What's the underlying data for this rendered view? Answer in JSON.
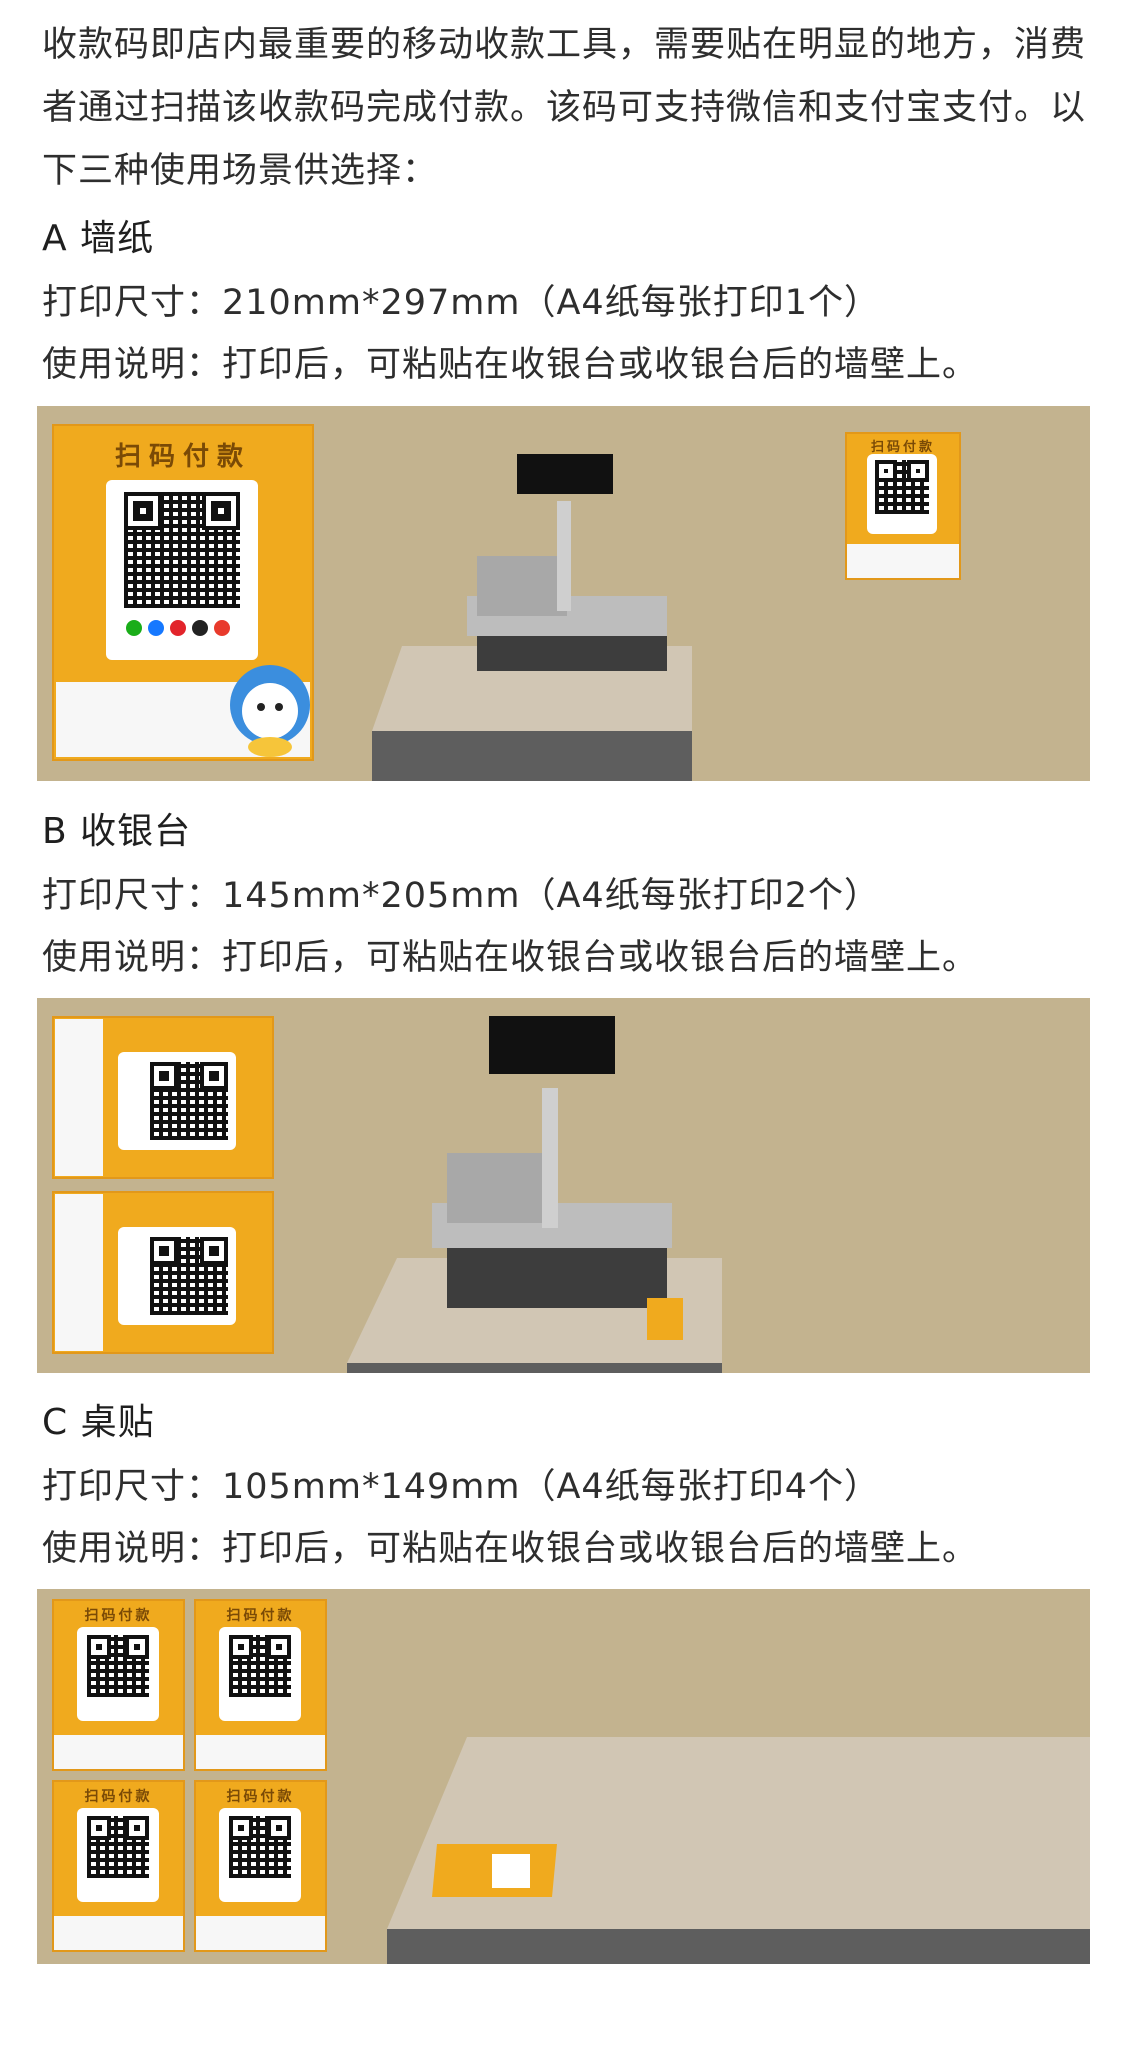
{
  "intro": {
    "text": "收款码即店内最重要的移动收款工具，需要贴在明显的地方，消费者通过扫描该收款码完成付款。该码可支持微信和支付宝支付。以下三种使用场景供选择："
  },
  "options": [
    {
      "heading": "A 墙纸",
      "size": "打印尺寸：210mm*297mm（A4纸每张打印1个）",
      "usage": "使用说明：打印后，可粘贴在收银台或收银台后的墙壁上。"
    },
    {
      "heading": "B 收银台",
      "size": "打印尺寸：145mm*205mm（A4纸每张打印2个）",
      "usage": "使用说明：打印后，可粘贴在收银台或收银台后的墙壁上。"
    },
    {
      "heading": "C 桌贴",
      "size": "打印尺寸：105mm*149mm（A4纸每张打印4个）",
      "usage": "使用说明：打印后，可粘贴在收银台或收银台后的墙壁上。"
    }
  ],
  "poster": {
    "title": "扫码付款"
  },
  "colors": {
    "poster_yellow": "#f0aa1e",
    "scene_wall": "#c3b38f",
    "counter_top": "#d1c6b4",
    "counter_side": "#5e5e5e"
  },
  "icons": [
    "wechat-pay-icon",
    "alipay-icon",
    "unionpay-icon",
    "qq-wallet-icon",
    "mascot-icon"
  ]
}
